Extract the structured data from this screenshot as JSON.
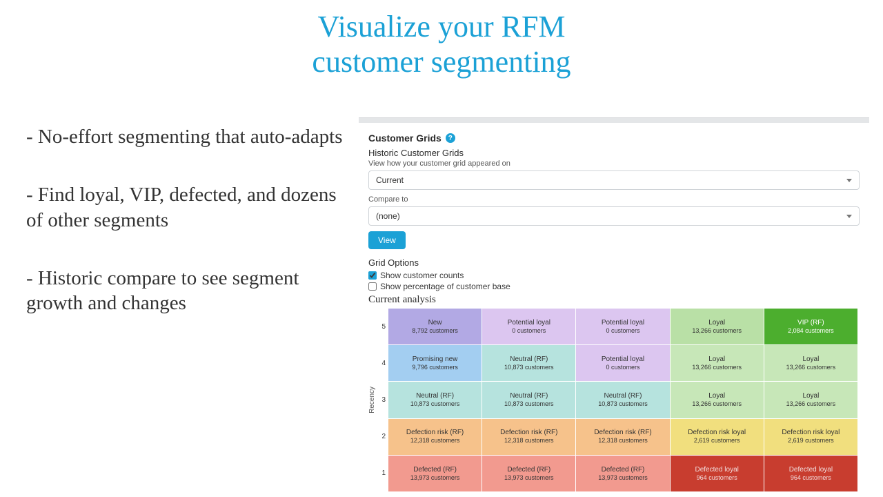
{
  "slide": {
    "title_line1": "Visualize your RFM",
    "title_line2": "customer segmenting",
    "bullets": [
      "- No-effort segmenting that auto-adapts",
      "- Find loyal, VIP, defected, and dozens of other segments",
      "- Historic compare to see segment growth and changes"
    ]
  },
  "panel": {
    "title": "Customer Grids",
    "help_icon": "?",
    "historic_title": "Historic Customer Grids",
    "view_label": "View how your customer grid appeared on",
    "view_select": "Current",
    "compare_label": "Compare to",
    "compare_select": "(none)",
    "view_button": "View",
    "options_title": "Grid Options",
    "opt_counts": "Show customer counts",
    "opt_pct": "Show percentage of customer base",
    "analysis_title": "Current analysis",
    "y_axis": "Recency",
    "row_labels": [
      "5",
      "4",
      "3",
      "2",
      "1"
    ]
  },
  "grid_rows": [
    [
      {
        "seg": "New",
        "cnt": "8,792 customers",
        "cls": "c-new"
      },
      {
        "seg": "Potential loyal",
        "cnt": "0 customers",
        "cls": "c-potential"
      },
      {
        "seg": "Potential loyal",
        "cnt": "0 customers",
        "cls": "c-potential"
      },
      {
        "seg": "Loyal",
        "cnt": "13,266 customers",
        "cls": "c-loyal"
      },
      {
        "seg": "VIP (RF)",
        "cnt": "2,084 customers",
        "cls": "c-vip"
      }
    ],
    [
      {
        "seg": "Promising new",
        "cnt": "9,796 customers",
        "cls": "c-promising"
      },
      {
        "seg": "Neutral (RF)",
        "cnt": "10,873 customers",
        "cls": "c-neutral"
      },
      {
        "seg": "Potential loyal",
        "cnt": "0 customers",
        "cls": "c-potential"
      },
      {
        "seg": "Loyal",
        "cnt": "13,266 customers",
        "cls": "c-loyal2"
      },
      {
        "seg": "Loyal",
        "cnt": "13,266 customers",
        "cls": "c-loyal2"
      }
    ],
    [
      {
        "seg": "Neutral (RF)",
        "cnt": "10,873 customers",
        "cls": "c-neutral"
      },
      {
        "seg": "Neutral (RF)",
        "cnt": "10,873 customers",
        "cls": "c-neutral"
      },
      {
        "seg": "Neutral (RF)",
        "cnt": "10,873 customers",
        "cls": "c-neutral"
      },
      {
        "seg": "Loyal",
        "cnt": "13,266 customers",
        "cls": "c-loyal2"
      },
      {
        "seg": "Loyal",
        "cnt": "13,266 customers",
        "cls": "c-loyal2"
      }
    ],
    [
      {
        "seg": "Defection risk (RF)",
        "cnt": "12,318 customers",
        "cls": "c-defrisk"
      },
      {
        "seg": "Defection risk (RF)",
        "cnt": "12,318 customers",
        "cls": "c-defrisk"
      },
      {
        "seg": "Defection risk (RF)",
        "cnt": "12,318 customers",
        "cls": "c-defrisk"
      },
      {
        "seg": "Defection risk loyal",
        "cnt": "2,619 customers",
        "cls": "c-defloyal"
      },
      {
        "seg": "Defection risk loyal",
        "cnt": "2,619 customers",
        "cls": "c-defloyal"
      }
    ],
    [
      {
        "seg": "Defected (RF)",
        "cnt": "13,973 customers",
        "cls": "c-defected"
      },
      {
        "seg": "Defected (RF)",
        "cnt": "13,973 customers",
        "cls": "c-defected"
      },
      {
        "seg": "Defected (RF)",
        "cnt": "13,973 customers",
        "cls": "c-defected"
      },
      {
        "seg": "Defected loyal",
        "cnt": "964 customers",
        "cls": "c-defloy2"
      },
      {
        "seg": "Defected loyal",
        "cnt": "964 customers",
        "cls": "c-defloy2"
      }
    ]
  ]
}
